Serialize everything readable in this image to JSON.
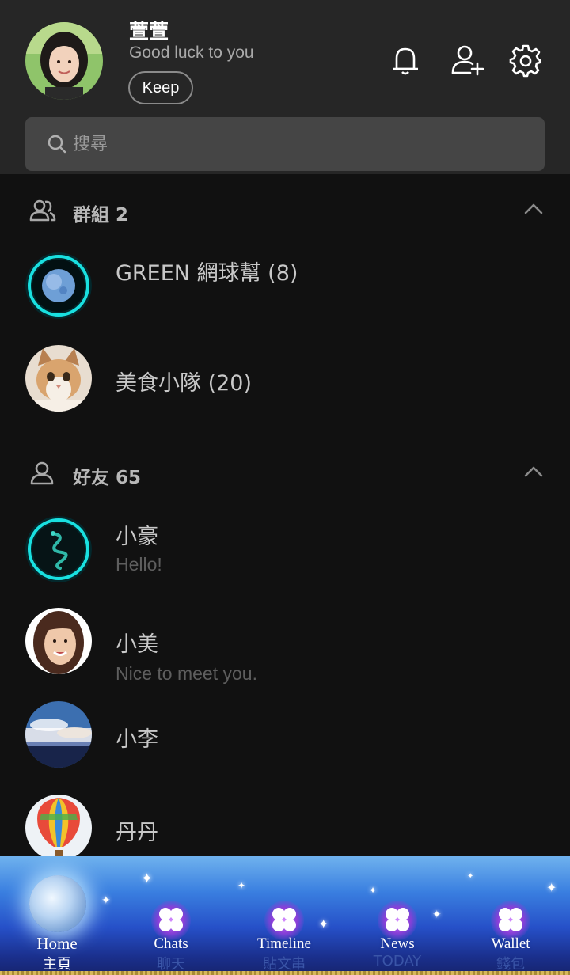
{
  "profile": {
    "name": "萱萱",
    "status": "Good luck to you",
    "keep_label": "Keep"
  },
  "header_icons": [
    "bell-icon",
    "add-friend-icon",
    "settings-gear-icon"
  ],
  "search": {
    "placeholder": "搜尋"
  },
  "groups": {
    "title": "群組 2",
    "items": [
      {
        "name": "GREEN 網球幫 (8)",
        "avatar": "blue-moon-avatar"
      },
      {
        "name": "美食小隊 (20)",
        "avatar": "cat-avatar"
      }
    ]
  },
  "friends": {
    "title": "好友 65",
    "items": [
      {
        "name": "小豪",
        "message": "Hello!",
        "avatar": "teal-dragon-avatar"
      },
      {
        "name": "小美",
        "message": "Nice to meet you.",
        "avatar": "woman-avatar"
      },
      {
        "name": "小李",
        "message": "",
        "avatar": "sky-avatar"
      },
      {
        "name": "丹丹",
        "message": "",
        "avatar": "balloon-avatar"
      }
    ]
  },
  "bottom_nav": {
    "tabs": [
      {
        "en": "Home",
        "zh": "主頁",
        "active": true
      },
      {
        "en": "Chats",
        "zh": "聊天",
        "active": false
      },
      {
        "en": "Timeline",
        "zh": "貼文串",
        "active": false
      },
      {
        "en": "News",
        "zh": "TODAY",
        "active": false
      },
      {
        "en": "Wallet",
        "zh": "錢包",
        "active": false
      }
    ]
  },
  "colors": {
    "background": "#111111",
    "header": "#262626",
    "search_field": "#454545",
    "nav_blue": "#2650c8",
    "glow_cyan": "#19e0e0"
  }
}
